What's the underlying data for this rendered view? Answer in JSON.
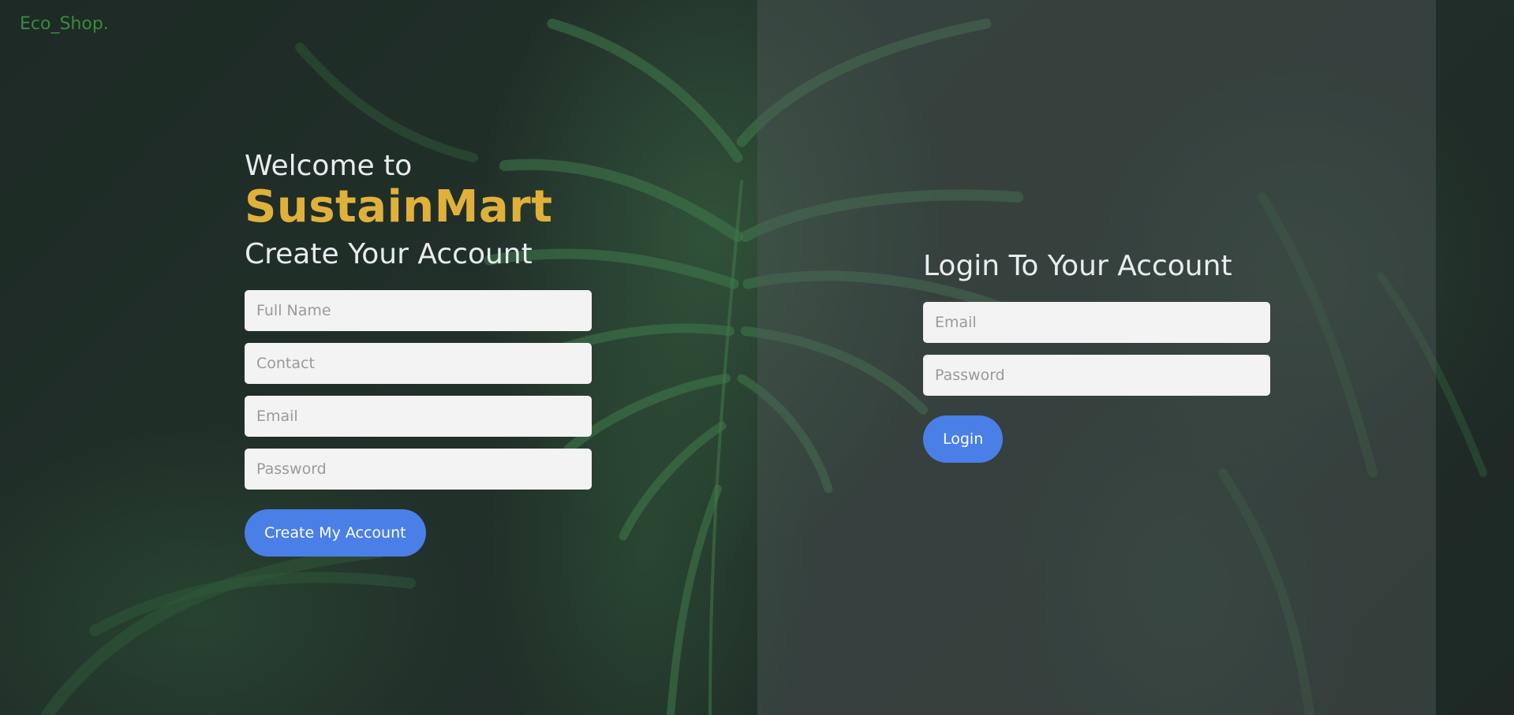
{
  "brand_logo": "Eco_Shop.",
  "signup": {
    "welcome": "Welcome to",
    "brand_name": "SustainMart",
    "title": "Create Your Account",
    "fields": {
      "full_name_placeholder": "Full Name",
      "contact_placeholder": "Contact",
      "email_placeholder": "Email",
      "password_placeholder": "Password"
    },
    "submit_label": "Create My Account"
  },
  "login": {
    "title": "Login To Your Account",
    "fields": {
      "email_placeholder": "Email",
      "password_placeholder": "Password"
    },
    "submit_label": "Login"
  },
  "colors": {
    "brand_accent": "#e0b13a",
    "logo": "#3a8a3e",
    "button": "#4a7fe8"
  }
}
